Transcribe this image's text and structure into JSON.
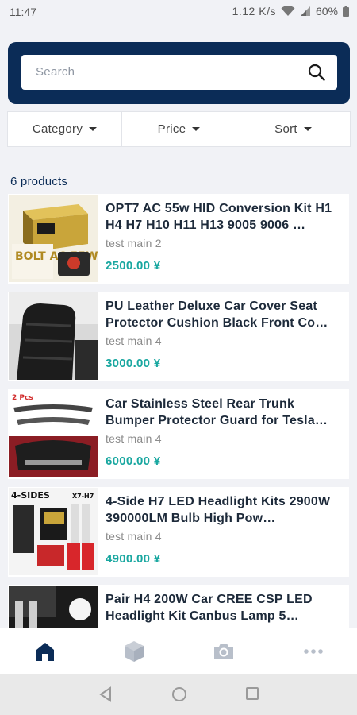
{
  "status_bar": {
    "time": "11:47",
    "speed": "1.12 K/s",
    "battery": "60%"
  },
  "search": {
    "placeholder": "Search"
  },
  "filters": [
    {
      "label": "Category"
    },
    {
      "label": "Price"
    },
    {
      "label": "Sort"
    }
  ],
  "results": {
    "count_label": "6 products"
  },
  "products": [
    {
      "title": "OPT7 AC 55w HID Conversion Kit H1 H4 H7 H10 H11 H13 9005 9006 …",
      "subtitle": "test main 2",
      "price": "2500.00 ¥",
      "image_text": "BOLT AC 55W"
    },
    {
      "title": "PU Leather Deluxe Car Cover Seat Protector Cushion Black Front Co…",
      "subtitle": "test main 4",
      "price": "3000.00 ¥"
    },
    {
      "title": "Car Stainless Steel Rear Trunk Bumper Protector Guard for Tesla…",
      "subtitle": "test main 4",
      "price": "6000.00 ¥",
      "image_text": "2 Pcs"
    },
    {
      "title": "4-Side H7 LED Headlight Kits 2900W 390000LM Bulb High Pow…",
      "subtitle": "test main 4",
      "price": "4900.00 ¥",
      "image_text": "4-SIDES",
      "image_text_2": "X7-H7"
    },
    {
      "title": "Pair H4 200W Car CREE CSP LED Headlight Kit Canbus Lamp 5…",
      "subtitle": "",
      "price": ""
    }
  ],
  "bottom_nav": [
    {
      "icon": "home-icon",
      "active": true
    },
    {
      "icon": "box-icon",
      "active": false
    },
    {
      "icon": "camera-icon",
      "active": false
    },
    {
      "icon": "more-icon",
      "active": false
    }
  ],
  "colors": {
    "header": "#0b2c57",
    "price": "#19a7a0",
    "nav_active": "#0b2c57",
    "nav_inactive": "#b8bfca"
  }
}
